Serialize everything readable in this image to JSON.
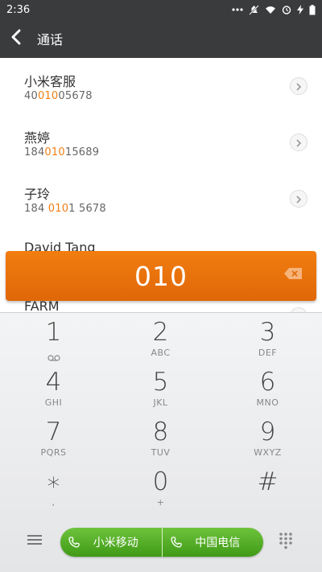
{
  "status_bar": {
    "time": "2:36",
    "icons": [
      "more-dots-icon",
      "mute-icon",
      "wifi-icon",
      "alarm-icon",
      "charging-icon",
      "battery-icon"
    ]
  },
  "header": {
    "title": "通话"
  },
  "contacts": [
    {
      "name": "小米客服",
      "number_pre": "40",
      "number_hl": "010",
      "number_post": "05678"
    },
    {
      "name": "燕婷",
      "number_pre": "184",
      "number_hl": "010",
      "number_post": "15689"
    },
    {
      "name": "子玲",
      "number_pre": "184 ",
      "number_hl": "010",
      "number_post": "1 5678"
    },
    {
      "name": "David Tang",
      "number_pre": "",
      "number_hl": "",
      "number_post": ""
    },
    {
      "name": "FARM",
      "number_pre": "",
      "number_hl": "",
      "number_post": ""
    }
  ],
  "dialed": "010",
  "keys": [
    {
      "digit": "1",
      "letters": ""
    },
    {
      "digit": "2",
      "letters": "ABC"
    },
    {
      "digit": "3",
      "letters": "DEF"
    },
    {
      "digit": "4",
      "letters": "GHI"
    },
    {
      "digit": "5",
      "letters": "JKL"
    },
    {
      "digit": "6",
      "letters": "MNO"
    },
    {
      "digit": "7",
      "letters": "PQRS"
    },
    {
      "digit": "8",
      "letters": "TUV"
    },
    {
      "digit": "9",
      "letters": "WXYZ"
    },
    {
      "digit": "∗",
      "letters": ","
    },
    {
      "digit": "0",
      "letters": "+"
    },
    {
      "digit": "#",
      "letters": ""
    }
  ],
  "call_buttons": [
    {
      "label": "小米移动"
    },
    {
      "label": "中国电信"
    }
  ],
  "colors": {
    "accent": "#f07f14",
    "call_green": "#4fae22",
    "header_bg": "#3a3b3d"
  }
}
